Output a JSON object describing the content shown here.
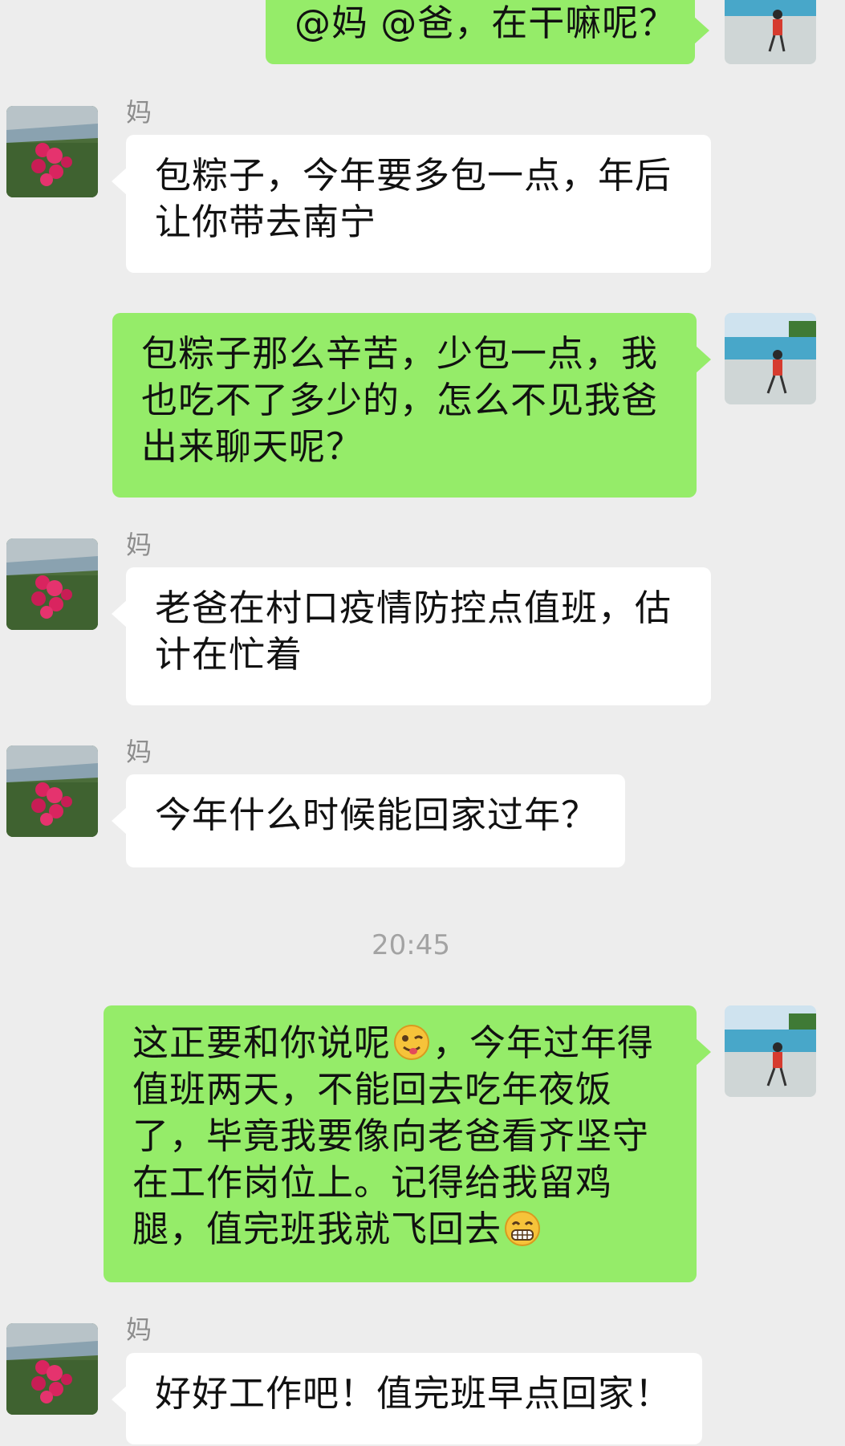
{
  "messages": {
    "m1": {
      "lines": [
        "@妈 @爸，在干嘛呢？"
      ]
    },
    "m2": {
      "sender": "妈",
      "lines": [
        "包粽子，今年要多包一点，年后",
        "让你带去南宁"
      ]
    },
    "m3": {
      "lines": [
        "包粽子那么辛苦，少包一点，我",
        "也吃不了多少的，怎么不见我爸",
        "出来聊天呢？"
      ]
    },
    "m4": {
      "sender": "妈",
      "lines": [
        "老爸在村口疫情防控点值班，估",
        "计在忙着"
      ]
    },
    "m5": {
      "sender": "妈",
      "lines": [
        "今年什么时候能回家过年？"
      ]
    },
    "m6": {
      "line1_before": "这正要和你说呢",
      "line1_after": "，今年过年得",
      "line2": "值班两天，不能回去吃年夜饭",
      "line3": "了，毕竟我要像向老爸看齐坚守",
      "line4": "在工作岗位上。记得给我留鸡",
      "line5": "腿，值完班我就飞回去",
      "emoji1": "wink-tongue-emoji",
      "emoji2": "grin-emoji"
    },
    "m7": {
      "sender": "妈",
      "lines": [
        "好好工作吧！值完班早点回家！"
      ]
    }
  },
  "timestamp": "20:45",
  "colors": {
    "background": "#ededed",
    "own_bubble": "#95ec69",
    "other_bubble": "#ffffff",
    "name_text": "#8d8d8d"
  },
  "icons": {
    "mom_avatar": "flower-avatar-icon",
    "own_avatar": "pool-person-avatar-icon"
  }
}
